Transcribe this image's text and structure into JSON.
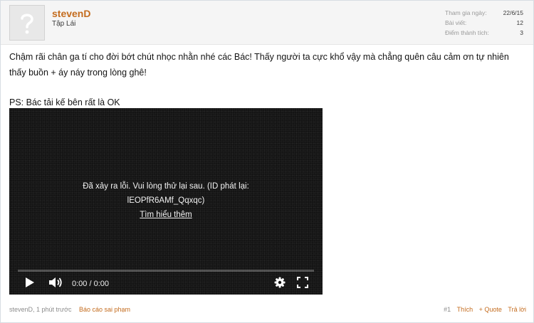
{
  "user": {
    "name": "stevenD",
    "title": "Tập Lái"
  },
  "stats": [
    {
      "label": "Tham gia ngày:",
      "value": "22/6/15"
    },
    {
      "label": "Bài viết:",
      "value": "12"
    },
    {
      "label": "Điểm thành tích:",
      "value": "3"
    }
  ],
  "message": {
    "line1": "Chậm rãi chân ga tí cho đời bớt chút nhọc nhằn nhé các Bác! Thấy người ta cực khổ vậy mà chẳng quên câu cảm ơn tự nhiên thấy buồn + áy náy trong lòng ghê!",
    "ps": "PS: Bác tải kế bên rất là OK"
  },
  "video": {
    "error_line1": "Đã xảy ra lỗi. Vui lòng thử lại sau. (ID phát lại:",
    "error_line2": "lEOPfR6AMf_Qqxqc)",
    "learn_more": "Tìm hiểu thêm",
    "time": "0:00 / 0:00",
    "progress": 0
  },
  "footer": {
    "meta": "stevenD, 1 phút trước",
    "report": "Báo cáo sai phạm",
    "post_number": "#1",
    "like": "Thích",
    "quote": "+ Quote",
    "reply": "Trả lời"
  },
  "colors": {
    "accent": "#c46c1e",
    "video_bg": "#141414"
  }
}
